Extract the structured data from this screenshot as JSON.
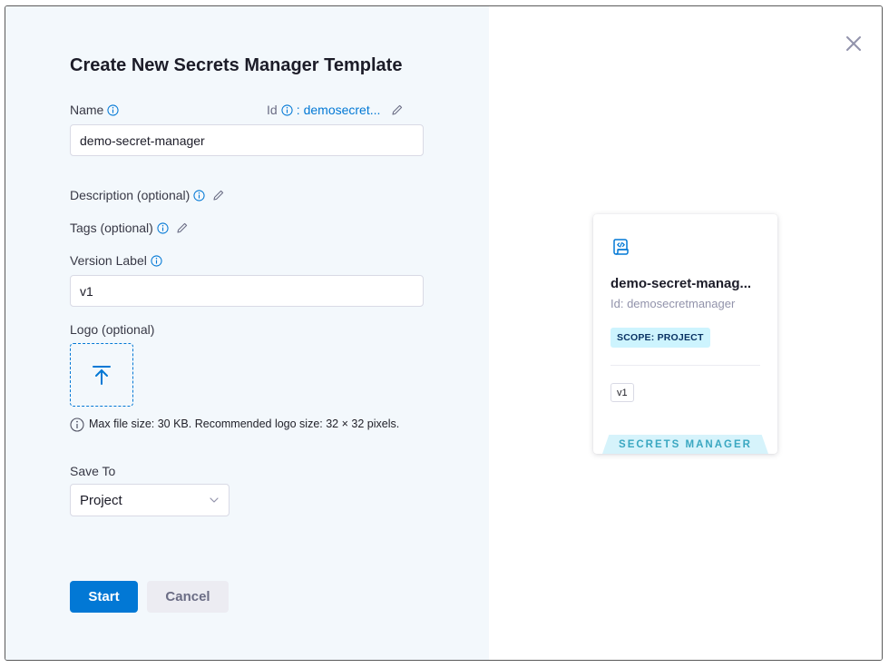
{
  "dialog": {
    "title": "Create New Secrets Manager Template",
    "close_icon": "close-icon"
  },
  "form": {
    "name_label": "Name",
    "name_value": "demo-secret-manager",
    "id_label": "Id",
    "id_separator": ":",
    "id_value": "demosecret...",
    "description_label": "Description (optional)",
    "tags_label": "Tags (optional)",
    "version_label": "Version Label",
    "version_value": "v1",
    "logo_label": "Logo (optional)",
    "logo_hint": "Max file size: 30 KB. Recommended logo size: 32 × 32 pixels.",
    "save_to_label": "Save To",
    "save_to_value": "Project"
  },
  "actions": {
    "start_label": "Start",
    "cancel_label": "Cancel"
  },
  "preview_card": {
    "name": "demo-secret-manag...",
    "id_text": "Id: demosecretmanager",
    "scope_badge": "SCOPE: PROJECT",
    "version_tag": "v1",
    "type_ribbon": "SECRETS MANAGER"
  },
  "colors": {
    "accent": "#0278d5",
    "left_pane_bg": "#f3f8fc",
    "scope_badge_bg": "#cdf4fe",
    "ribbon_bg": "#d6f3fb"
  }
}
